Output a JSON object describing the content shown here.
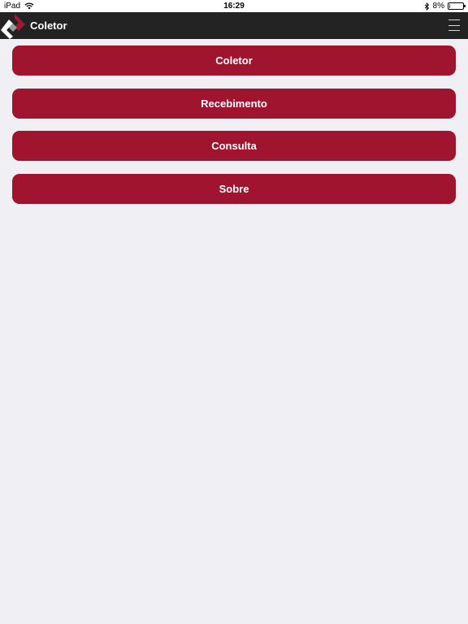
{
  "status_bar": {
    "device": "iPad",
    "time": "16:29",
    "battery": "8%",
    "battery_level": 0.08,
    "icons": [
      "wifi-icon",
      "bluetooth-icon",
      "battery-icon"
    ]
  },
  "header": {
    "title": "Coletor",
    "logo_icon": "app-logo-icon",
    "menu_icon": "hamburger-menu-icon"
  },
  "menu": {
    "items": [
      {
        "label": "Coletor"
      },
      {
        "label": "Recebimento"
      },
      {
        "label": "Consulta"
      },
      {
        "label": "Sobre"
      }
    ]
  },
  "colors": {
    "button": "#a0142f",
    "header": "#232323",
    "background": "#efeff4",
    "logo_red": "#9b1b30",
    "battery_low": "#d0021b"
  }
}
